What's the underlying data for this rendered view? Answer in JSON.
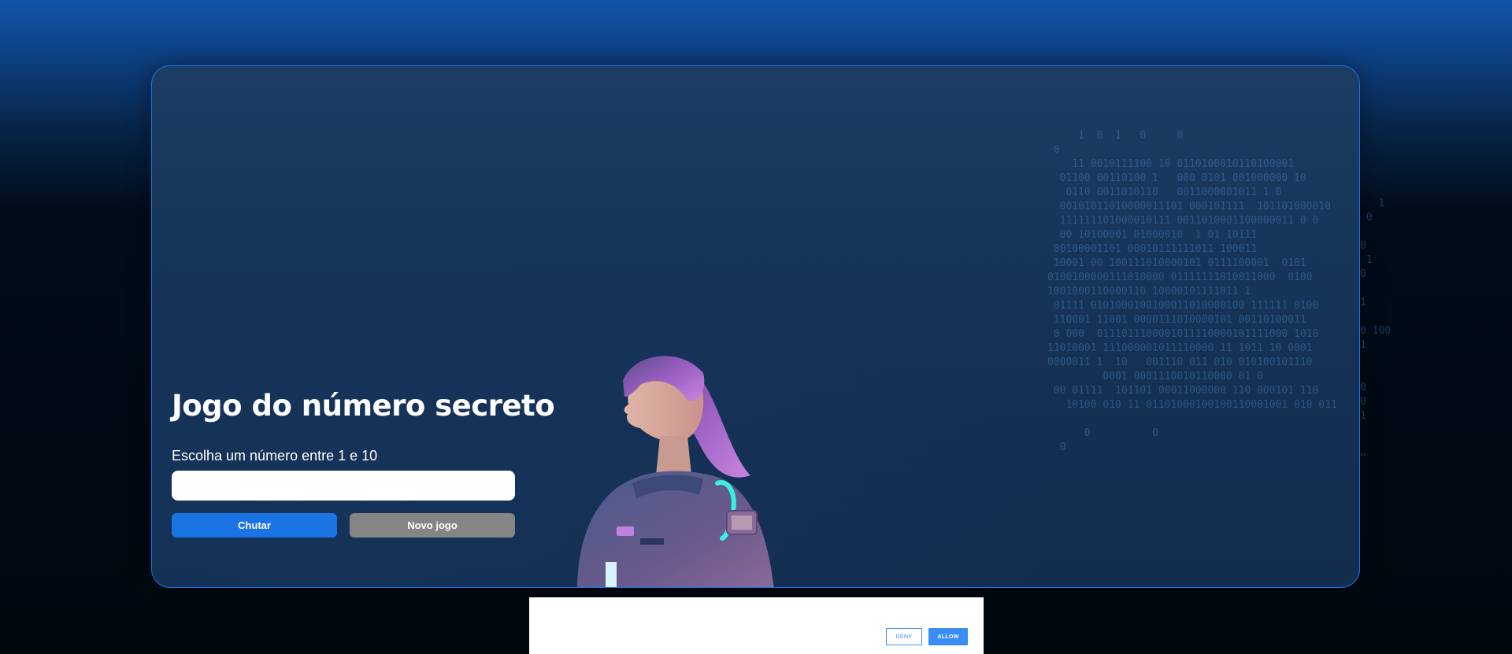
{
  "game": {
    "title": "Jogo do número secreto",
    "instruction": "Escolha um número entre 1 e 10",
    "input_value": "",
    "guess_button": "Chutar",
    "new_game_button": "Novo jogo"
  },
  "consent": {
    "deny_label": "DENY",
    "allow_label": "ALLOW"
  },
  "decor": {
    "binary_text": "           1  0  1   0     0\n       0\n          11 0010111100 10 0110100010110100001\n        01100 00110100 1   000 0101 001000000 10\n         0110 0011010110   0011000001011 1 0\n        00101011010000011101 000101111  101101000010\n        111111101000010111 0011010001100000011 0 0\n        00 10100001 01000010  1 01 10111\n       00100001101 00010111111011 100011\n       10001 00 100111010000101 0111100001  0101\n      0100100000111010000 01111111010011000  0100\n      1001000110000110 10000101111011 1\n       01111 0101000100100011010000100 111111 0100\n       110001 11001 0000111010000101 00110100011\n       0 000  0111011100001011110000101111000 1010\n      11010001 111000001011110000 11 1011 10 0001\n      0000011 1  10   001110 011 010 010100101110\n               0001 0001110010110000 01 0\n       00 01111  101101 00011000000 110 000101 110\n         10100 010 11 01101000100100110001001 010 011\n\n            0          0\n        0",
    "binary_outside": "   1\n 0\n\n0\n 1\n0\n\n1\n\n0 100\n1\n\n\n0\n0\n1\n\n\n0"
  },
  "colors": {
    "accent_blue": "#1b74e4",
    "secondary_gray": "#858585",
    "card_border": "#1875e8",
    "consent_blue": "#3a8df5"
  }
}
